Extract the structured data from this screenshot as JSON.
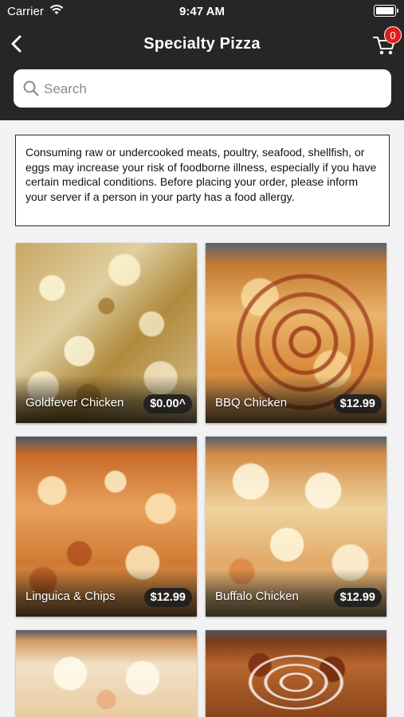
{
  "status_bar": {
    "carrier": "Carrier",
    "time": "9:47 AM"
  },
  "nav": {
    "title": "Specialty Pizza",
    "cart_count": "0"
  },
  "search": {
    "placeholder": "Search"
  },
  "notice": "Consuming raw or undercooked meats, poultry, seafood, shellfish, or eggs may increase your risk of foodborne illness, especially if you have certain medical conditions. Before placing your order, please inform your server if a person in your party has a food allergy.",
  "items": [
    {
      "name": "Goldfever Chicken",
      "price": "$0.00^"
    },
    {
      "name": "BBQ Chicken",
      "price": "$12.99"
    },
    {
      "name": "Linguica & Chips",
      "price": "$12.99"
    },
    {
      "name": "Buffalo Chicken",
      "price": "$12.99"
    },
    {
      "name": "",
      "price": ""
    },
    {
      "name": "",
      "price": ""
    }
  ],
  "colors": {
    "header_bg": "#262626",
    "badge": "#e41b1b",
    "page_bg": "#f2f2f2"
  }
}
